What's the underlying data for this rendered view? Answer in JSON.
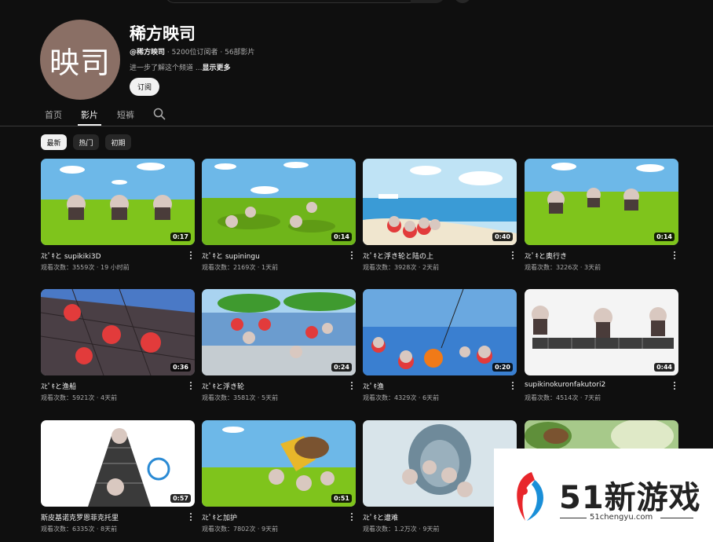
{
  "channel": {
    "avatar_text": "映司",
    "name": "稀方映司",
    "handle": "@稀方映司",
    "stats": "· 5200位订阅者 · 56部影片",
    "description": "进一步了解这个频道 ...",
    "show_more": "显示更多",
    "subscribe_label": "订阅"
  },
  "tabs": [
    {
      "label": "首页"
    },
    {
      "label": "影片"
    },
    {
      "label": "短裤"
    }
  ],
  "chips": [
    {
      "label": "最新"
    },
    {
      "label": "热门"
    },
    {
      "label": "初期"
    }
  ],
  "videos": [
    {
      "title": "ｽﾋﾟｷと supikiki3D",
      "meta": "观看次数：3559次 · 19 小时前",
      "duration": "0:17"
    },
    {
      "title": "ｽﾋﾟｷと supiningu",
      "meta": "观看次数：2169次 · 1天前",
      "duration": "0:14"
    },
    {
      "title": "ｽﾋﾟｷと浮き轮と陆の上",
      "meta": "观看次数：3928次 · 2天前",
      "duration": "0:40"
    },
    {
      "title": "ｽﾋﾟｷと奥行き",
      "meta": "观看次数：3226次 · 3天前",
      "duration": "0:14"
    },
    {
      "title": "ｽﾋﾟｷと渔船",
      "meta": "观看次数：5921次 · 4天前",
      "duration": "0:36"
    },
    {
      "title": "ｽﾋﾟｷと浮き轮",
      "meta": "观看次数：3581次 · 5天前",
      "duration": "0:24"
    },
    {
      "title": "ｽﾋﾟｷ渔",
      "meta": "观看次数：4329次 · 6天前",
      "duration": "0:20"
    },
    {
      "title": "supikinokuronfakutori2",
      "meta": "观看次数：4514次 · 7天前",
      "duration": "0:44"
    },
    {
      "title": "斯皮基诺克罗恩菲克托里",
      "meta": "观看次数：6335次 · 8天前",
      "duration": "0:57"
    },
    {
      "title": "ｽﾋﾟｷと加护",
      "meta": "观看次数：7802次 · 9天前",
      "duration": "0:51"
    },
    {
      "title": "ｽﾋﾟｷと遭难",
      "meta": "观看次数：1.2万次 · 9天前",
      "duration": ""
    },
    {
      "title": "",
      "meta": "",
      "duration": ""
    }
  ],
  "watermark": {
    "brand": "51新游戏",
    "url": "51chengyu.com"
  },
  "colors": {
    "background": "#0f0f0f",
    "text_primary": "#f1f1f1",
    "text_secondary": "#aaaaaa",
    "chip_bg": "#272727",
    "watermark_red": "#e8262b",
    "watermark_blue": "#1a8fd8"
  },
  "icons": {
    "tab_search": "search-icon",
    "card_menu": "more-vert-icon",
    "watermark_logo": "logo-icon"
  }
}
